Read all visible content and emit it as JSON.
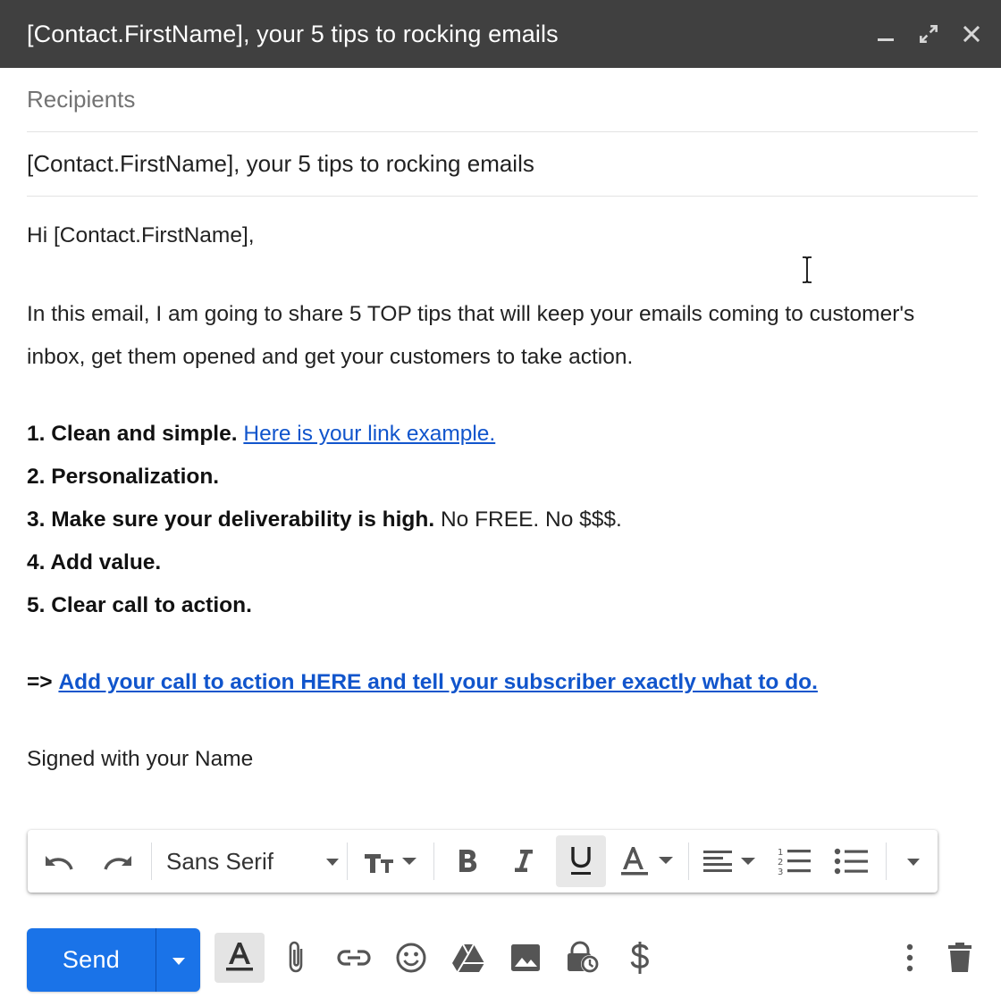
{
  "window": {
    "title": "[Contact.FirstName], your 5 tips to rocking emails",
    "minimize_icon": "minimize-icon",
    "expand_icon": "expand-icon",
    "close_icon": "close-icon",
    "title_bg": "#404040"
  },
  "compose": {
    "recipients_placeholder": "Recipients",
    "subject": "[Contact.FirstName], your 5 tips to rocking emails"
  },
  "body": {
    "greeting": "Hi [Contact.FirstName],",
    "intro_line1": "In this email, I am going to share 5 TOP tips that will keep your emails coming to customer's",
    "intro_line2": "inbox, get them opened and get your customers to take action.",
    "tips": [
      {
        "bold": "1. Clean and simple.",
        "link": "Here is your link example.",
        "plain": ""
      },
      {
        "bold": "2. Personalization.",
        "link": "",
        "plain": ""
      },
      {
        "bold": "3. Make sure your deliverability is high.",
        "link": "",
        "plain": "No FREE. No $$$."
      },
      {
        "bold": "4. Add value.",
        "link": "",
        "plain": ""
      },
      {
        "bold": "5. Clear call to action.",
        "link": "",
        "plain": ""
      }
    ],
    "cta_prefix": "=>",
    "cta_link": "Add your call to action HERE and tell your subscriber exactly what to do.",
    "signature": "Signed with your Name",
    "link_color": "#1155cc"
  },
  "format_toolbar": {
    "font_family": "Sans Serif",
    "buttons": [
      "undo",
      "redo",
      "font-family",
      "text-size",
      "bold",
      "italic",
      "underline",
      "text-color",
      "align",
      "numbered-list",
      "bulleted-list",
      "more-formatting"
    ],
    "active": "underline"
  },
  "bottom_bar": {
    "send_label": "Send",
    "send_color": "#1a73e8",
    "icons": [
      "formatting-options-icon",
      "attach-icon",
      "link-icon",
      "emoji-icon",
      "drive-icon",
      "photo-icon",
      "confidential-mode-icon",
      "dollar-icon",
      "more-options-icon",
      "discard-icon"
    ]
  }
}
